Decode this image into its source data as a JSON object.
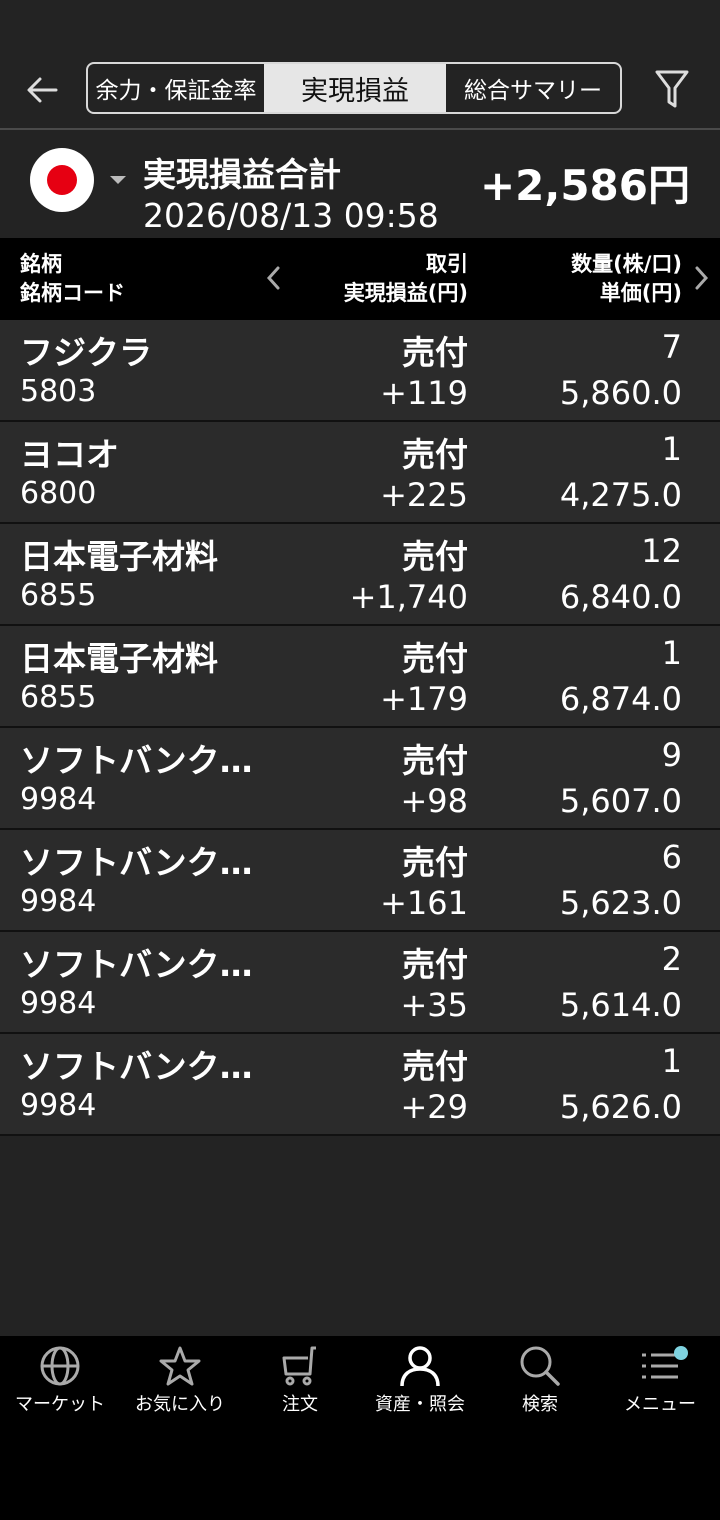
{
  "header": {
    "tabs": [
      "余力・保証金率",
      "実現損益",
      "総合サマリー"
    ],
    "active_tab": "実現損益"
  },
  "summary": {
    "title": "実現損益合計",
    "datetime": "2026/08/13 09:58",
    "total": "+2,586円"
  },
  "columns": {
    "col1_line1": "銘柄",
    "col1_line2": "銘柄コード",
    "col2_line1": "取引",
    "col2_line2": "実現損益(円)",
    "col3_line1": "数量(株/口)",
    "col3_line2": "単価(円)"
  },
  "rows": [
    {
      "name": "フジクラ",
      "code": "5803",
      "trade": "売付",
      "pl": "+119",
      "qty": "7",
      "price": "5,860.0"
    },
    {
      "name": "ヨコオ",
      "code": "6800",
      "trade": "売付",
      "pl": "+225",
      "qty": "1",
      "price": "4,275.0"
    },
    {
      "name": "日本電子材料",
      "code": "6855",
      "trade": "売付",
      "pl": "+1,740",
      "qty": "12",
      "price": "6,840.0"
    },
    {
      "name": "日本電子材料",
      "code": "6855",
      "trade": "売付",
      "pl": "+179",
      "qty": "1",
      "price": "6,874.0"
    },
    {
      "name": "ソフトバンク…",
      "code": "9984",
      "trade": "売付",
      "pl": "+98",
      "qty": "9",
      "price": "5,607.0"
    },
    {
      "name": "ソフトバンク…",
      "code": "9984",
      "trade": "売付",
      "pl": "+161",
      "qty": "6",
      "price": "5,623.0"
    },
    {
      "name": "ソフトバンク…",
      "code": "9984",
      "trade": "売付",
      "pl": "+35",
      "qty": "2",
      "price": "5,614.0"
    },
    {
      "name": "ソフトバンク…",
      "code": "9984",
      "trade": "売付",
      "pl": "+29",
      "qty": "1",
      "price": "5,626.0"
    }
  ],
  "nav": [
    {
      "label": "マーケット",
      "icon": "globe-icon"
    },
    {
      "label": "お気に入り",
      "icon": "star-icon"
    },
    {
      "label": "注文",
      "icon": "cart-icon"
    },
    {
      "label": "資産・照会",
      "icon": "person-icon"
    },
    {
      "label": "検索",
      "icon": "search-icon"
    },
    {
      "label": "メニュー",
      "icon": "menu-icon"
    }
  ],
  "colors": {
    "background": "#232323",
    "row": "#2b2b2b",
    "flag_red": "#e60012",
    "notify_dot": "#7fd3e0"
  }
}
